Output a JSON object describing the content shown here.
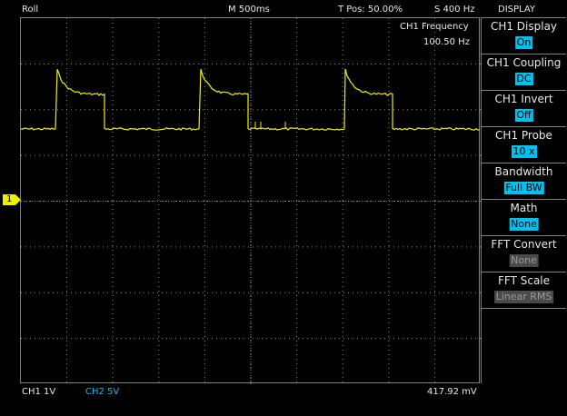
{
  "header": {
    "mode": "Roll",
    "timebase": "M 500ms",
    "trigger_pos": "T Pos: 50.00%",
    "sample_rate": "S 400 Hz",
    "menu_title": "DISPLAY"
  },
  "measurement": {
    "label": "CH1 Frequency",
    "value": "100.50 Hz"
  },
  "menu": {
    "items": [
      {
        "title": "CH1 Display",
        "value": "On",
        "style": "active"
      },
      {
        "title": "CH1 Coupling",
        "value": "DC",
        "style": "active"
      },
      {
        "title": "CH1 Invert",
        "value": "Off",
        "style": "active"
      },
      {
        "title": "CH1 Probe",
        "value": "10 x",
        "style": "active"
      },
      {
        "title": "Bandwidth",
        "value": "Full BW",
        "style": "active"
      },
      {
        "title": "Math",
        "value": "None",
        "style": "active"
      },
      {
        "title": "FFT Convert",
        "value": "None",
        "style": "dim"
      },
      {
        "title": "FFT Scale",
        "value": "Linear RMS",
        "style": "dim"
      }
    ]
  },
  "channel_marker": "1",
  "status": {
    "ch1": "CH1  1V",
    "ch2": "CH2  5V",
    "trigger_level": "417.92 mV"
  },
  "colors": {
    "ch1": "#f0f000",
    "ch2": "#00c0f0",
    "grid": "#8a8a8a",
    "active_value_bg": "#00c0f0"
  }
}
